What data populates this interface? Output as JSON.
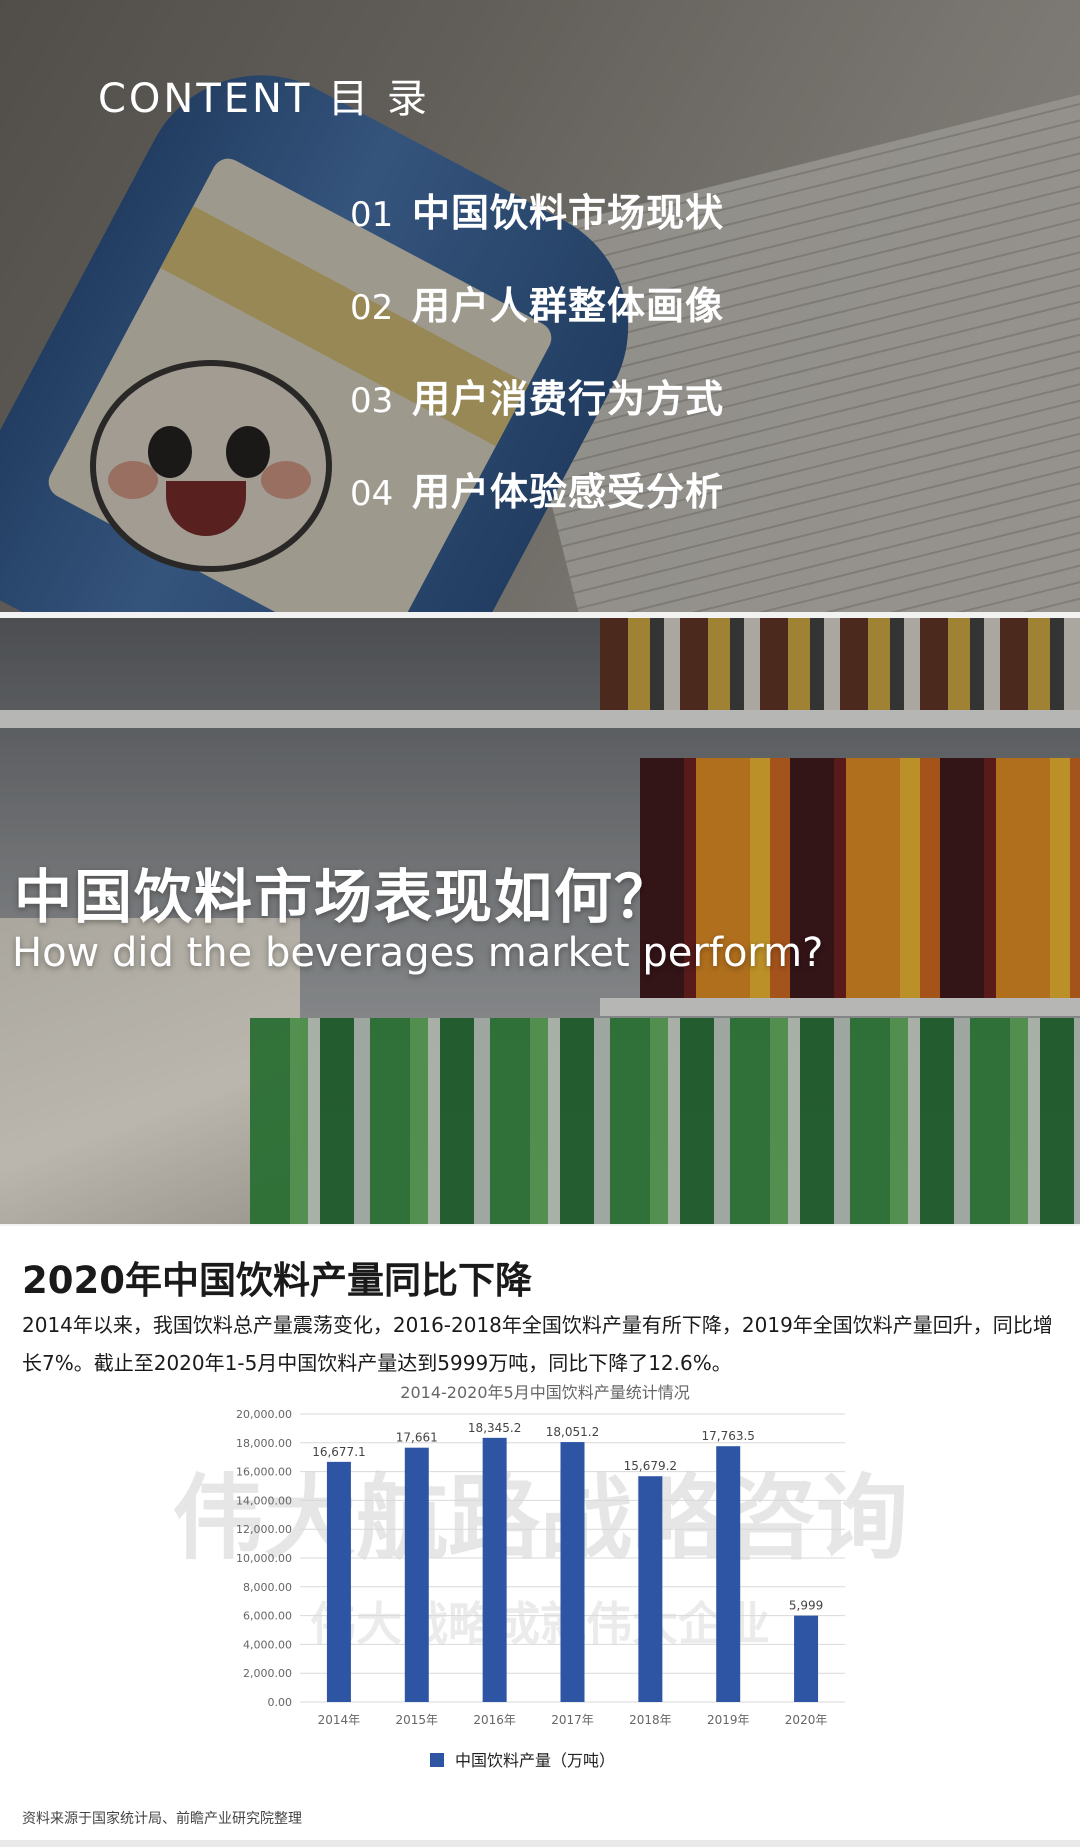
{
  "contents": {
    "heading": "CONTENT 目 录",
    "items": [
      {
        "num": "01",
        "text": "中国饮料市场现状"
      },
      {
        "num": "02",
        "text": "用户人群整体画像"
      },
      {
        "num": "03",
        "text": "用户消费行为方式"
      },
      {
        "num": "04",
        "text": "用户体验感受分析"
      }
    ]
  },
  "market": {
    "title_cn": "中国饮料市场表现如何？",
    "title_en": "How did the beverages market perform?"
  },
  "section": {
    "headline": "2020年中国饮料产量同比下降",
    "description": "2014年以来，我国饮料总产量震荡变化，2016-2018年全国饮料产量有所下降，2019年全国饮料产量回升，同比增长7%。截止至2020年1-5月中国饮料产量达到5999万吨，同比下降了12.6%。",
    "watermark_main": "伟大航路战略咨询",
    "watermark_sub": "伟大战略成就伟大企业",
    "source": "资料来源于国家统计局、前瞻产业研究院整理"
  },
  "chart_data": {
    "type": "bar",
    "title": "2014-2020年5月中国饮料产量统计情况",
    "categories": [
      "2014年",
      "2015年",
      "2016年",
      "2017年",
      "2018年",
      "2019年",
      "2020年"
    ],
    "series": [
      {
        "name": "中国饮料产量（万吨）",
        "values": [
          16677.1,
          17661,
          18345.2,
          18051.2,
          15679.2,
          17763.5,
          5999
        ]
      }
    ],
    "value_labels": [
      "16,677.1",
      "17,661",
      "18,345.2",
      "18,051.2",
      "15,679.2",
      "17,763.5",
      "5,999"
    ],
    "ylim": [
      0,
      20000
    ],
    "yticks": [
      "0.00",
      "2,000.00",
      "4,000.00",
      "6,000.00",
      "8,000.00",
      "10,000.00",
      "12,000.00",
      "14,000.00",
      "16,000.00",
      "18,000.00",
      "20,000.00"
    ],
    "ytick_values": [
      0,
      2000,
      4000,
      6000,
      8000,
      10000,
      12000,
      14000,
      16000,
      18000,
      20000
    ],
    "grid": true,
    "legend_position": "bottom",
    "bar_color": "#2e55a3"
  }
}
